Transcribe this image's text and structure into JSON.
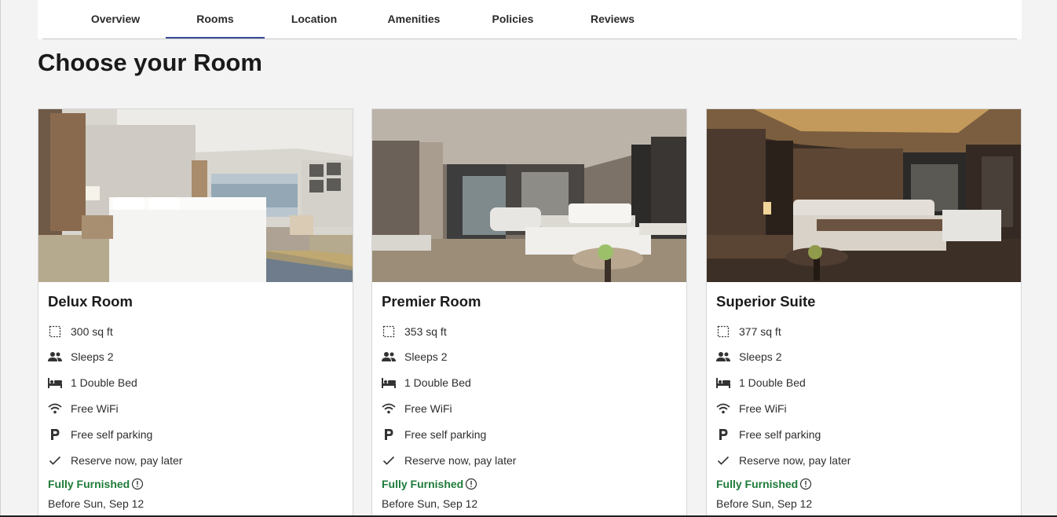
{
  "nav": {
    "tabs": [
      {
        "label": "Overview"
      },
      {
        "label": "Rooms",
        "active": true
      },
      {
        "label": "Location"
      },
      {
        "label": "Amenities"
      },
      {
        "label": "Policies"
      },
      {
        "label": "Reviews"
      }
    ],
    "active_color": "#3b4a9c"
  },
  "page_title": "Choose your Room",
  "rooms": [
    {
      "name": "Delux Room",
      "area": "300 sq ft",
      "sleeps": "Sleeps 2",
      "bed": "1 Double Bed",
      "wifi": "Free WiFi",
      "parking": "Free self parking",
      "reserve": "Reserve now, pay later",
      "furnished": "Fully Furnished",
      "before": "Before Sun, Sep 12"
    },
    {
      "name": "Premier Room",
      "area": "353 sq ft",
      "sleeps": "Sleeps 2",
      "bed": "1 Double Bed",
      "wifi": "Free WiFi",
      "parking": "Free self parking",
      "reserve": "Reserve now, pay later",
      "furnished": "Fully Furnished",
      "before": "Before Sun, Sep 12"
    },
    {
      "name": "Superior Suite",
      "area": "377 sq ft",
      "sleeps": "Sleeps 2",
      "bed": "1 Double Bed",
      "wifi": "Free WiFi",
      "parking": "Free self parking",
      "reserve": "Reserve now, pay later",
      "furnished": "Fully Furnished",
      "before": "Before Sun, Sep 12"
    }
  ],
  "icons": {
    "area": "area-icon",
    "sleeps": "people-icon",
    "bed": "bed-icon",
    "wifi": "wifi-icon",
    "parking": "parking-icon",
    "reserve": "check-icon",
    "info": "info-icon"
  },
  "colors": {
    "furnished": "#1e7b3a",
    "background": "#f3f3f3"
  }
}
